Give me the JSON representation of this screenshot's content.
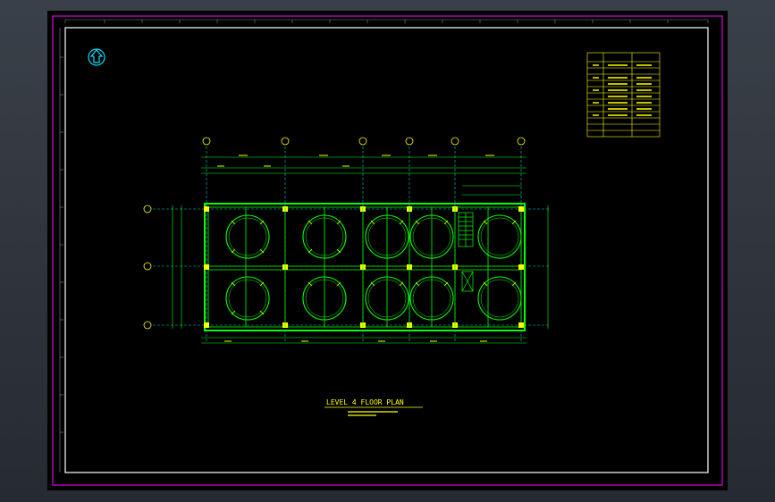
{
  "drawing": {
    "title": "LEVEL 4 FLOOR PLAN",
    "colors": {
      "background": "#000000",
      "sheet_border": "#c000c0",
      "frame": "#ffffff",
      "structure": "#00ff00",
      "grid_axis": "#00d0d0",
      "text": "#ffff00",
      "north_arrow": "#00e0ff"
    },
    "icons": [
      "north-arrow-icon"
    ]
  }
}
